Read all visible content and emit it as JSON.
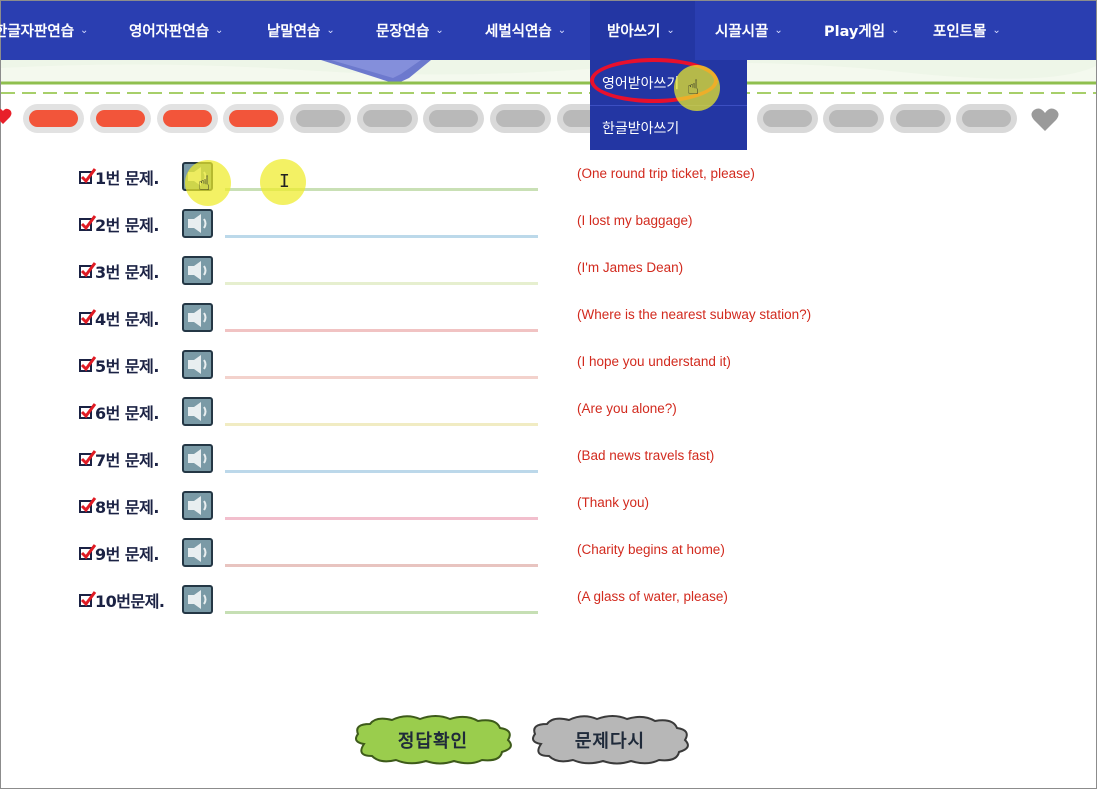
{
  "nav": {
    "items": [
      {
        "label": "한글자판연습"
      },
      {
        "label": "영어자판연습"
      },
      {
        "label": "낱말연습"
      },
      {
        "label": "문장연습"
      },
      {
        "label": "세벌식연습"
      },
      {
        "label": "받아쓰기"
      },
      {
        "label": "시끌시끌"
      },
      {
        "label": "Play게임"
      },
      {
        "label": "포인트몰"
      }
    ],
    "active": "받아쓰기",
    "dropdown": [
      {
        "label": "영어받아쓰기"
      },
      {
        "label": "한글받아쓰기"
      }
    ]
  },
  "progress": {
    "completed": 4,
    "total": 16
  },
  "questions": [
    {
      "label": "1번 문제.",
      "hint": "(One round trip ticket, please)",
      "value": ""
    },
    {
      "label": "2번 문제.",
      "hint": "(I lost my baggage)",
      "value": ""
    },
    {
      "label": "3번 문제.",
      "hint": "(I'm James Dean)",
      "value": ""
    },
    {
      "label": "4번 문제.",
      "hint": "(Where is the nearest subway station?)",
      "value": ""
    },
    {
      "label": "5번 문제.",
      "hint": "(I hope you understand it)",
      "value": ""
    },
    {
      "label": "6번 문제.",
      "hint": "(Are you alone?)",
      "value": ""
    },
    {
      "label": "7번 문제.",
      "hint": "(Bad news travels fast)",
      "value": ""
    },
    {
      "label": "8번 문제.",
      "hint": "(Thank you)",
      "value": ""
    },
    {
      "label": "9번 문제.",
      "hint": "(Charity begins at home)",
      "value": ""
    },
    {
      "label": "10번문제.",
      "hint": "(A glass of water, please)",
      "value": ""
    }
  ],
  "buttons": {
    "check": "정답확인",
    "retry": "문제다시"
  },
  "icons": {
    "speaker": "speaker-icon",
    "heart": "heart-icon",
    "check": "checkbox-icon",
    "chevron": "chevron-down-icon"
  },
  "colors": {
    "nav": "#2a3eb1",
    "hint": "#d22a1e",
    "pill_on": "#f2553a",
    "pill_off": "#b9b9b9",
    "check_btn": "#9acd4d",
    "retry_btn": "#b7b7b7"
  }
}
